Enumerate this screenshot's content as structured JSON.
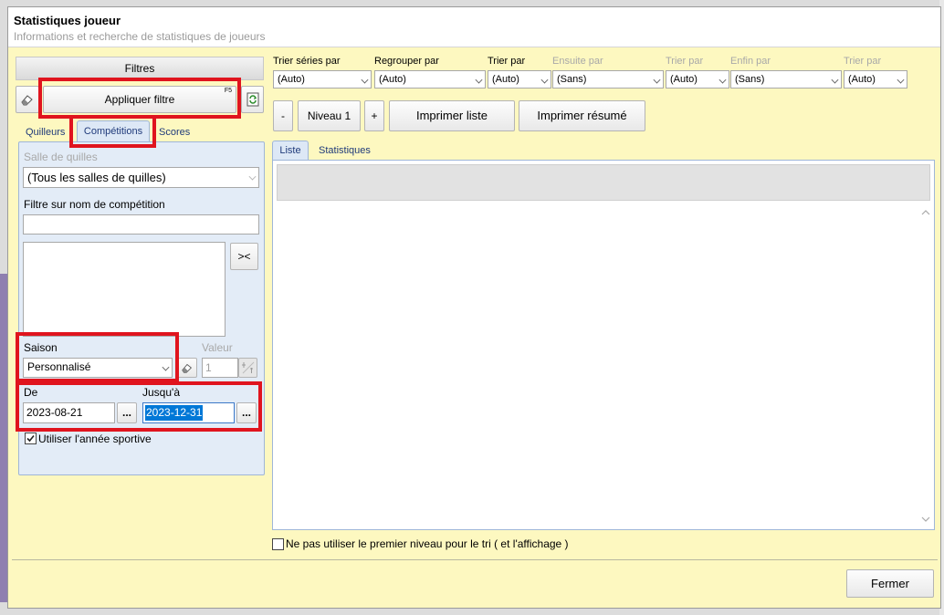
{
  "window": {
    "title": "Statistiques joueur",
    "subtitle": "Informations et recherche de statistiques de joueurs"
  },
  "filters": {
    "header": "Filtres",
    "apply_label": "Appliquer filtre",
    "apply_shortcut": "F5",
    "tabs": [
      "Quilleurs",
      "Compétitions",
      "Scores"
    ],
    "selected_tab": "Compétitions",
    "hall_label": "Salle de quilles",
    "hall_value": "(Tous les salles de quilles)",
    "competition_filter_label": "Filtre sur nom de compétition",
    "competition_filter_value": "",
    "swap_label": "><",
    "season_label": "Saison",
    "season_value": "Personnalisé",
    "value_label": "Valeur",
    "value_value": "1",
    "from_label": "De",
    "from_value": "2023-08-21",
    "to_label": "Jusqu'à",
    "to_value": "2023-12-31",
    "ellipsis": "...",
    "sport_year_label": "Utiliser l'année sportive",
    "sport_year_checked": true
  },
  "sorting": [
    {
      "label": "Trier séries par",
      "value": "(Auto)",
      "enabled": true
    },
    {
      "label": "Regrouper par",
      "value": "(Auto)",
      "enabled": true
    },
    {
      "label": "Trier par",
      "value": "(Auto)",
      "enabled": true
    },
    {
      "label": "Ensuite par",
      "value": "(Sans)",
      "enabled": true
    },
    {
      "label": "Trier par",
      "value": "(Auto)",
      "enabled": true
    },
    {
      "label": "Enfin par",
      "value": "(Sans)",
      "enabled": true
    },
    {
      "label": "Trier par",
      "value": "(Auto)",
      "enabled": true
    }
  ],
  "toolbar": {
    "minus": "-",
    "level": "Niveau 1",
    "plus": "+",
    "print_list": "Imprimer liste",
    "print_summary": "Imprimer résumé"
  },
  "result_tabs": [
    "Liste",
    "Statistiques"
  ],
  "no_first_level_label": "Ne pas utiliser le premier niveau pour le tri ( et l'affichage )",
  "close_label": "Fermer",
  "colors": {
    "window_bg": "#fdf8c0",
    "panel_bg": "#e3ecf7",
    "highlight": "#e0141e",
    "selection": "#0078d7"
  }
}
